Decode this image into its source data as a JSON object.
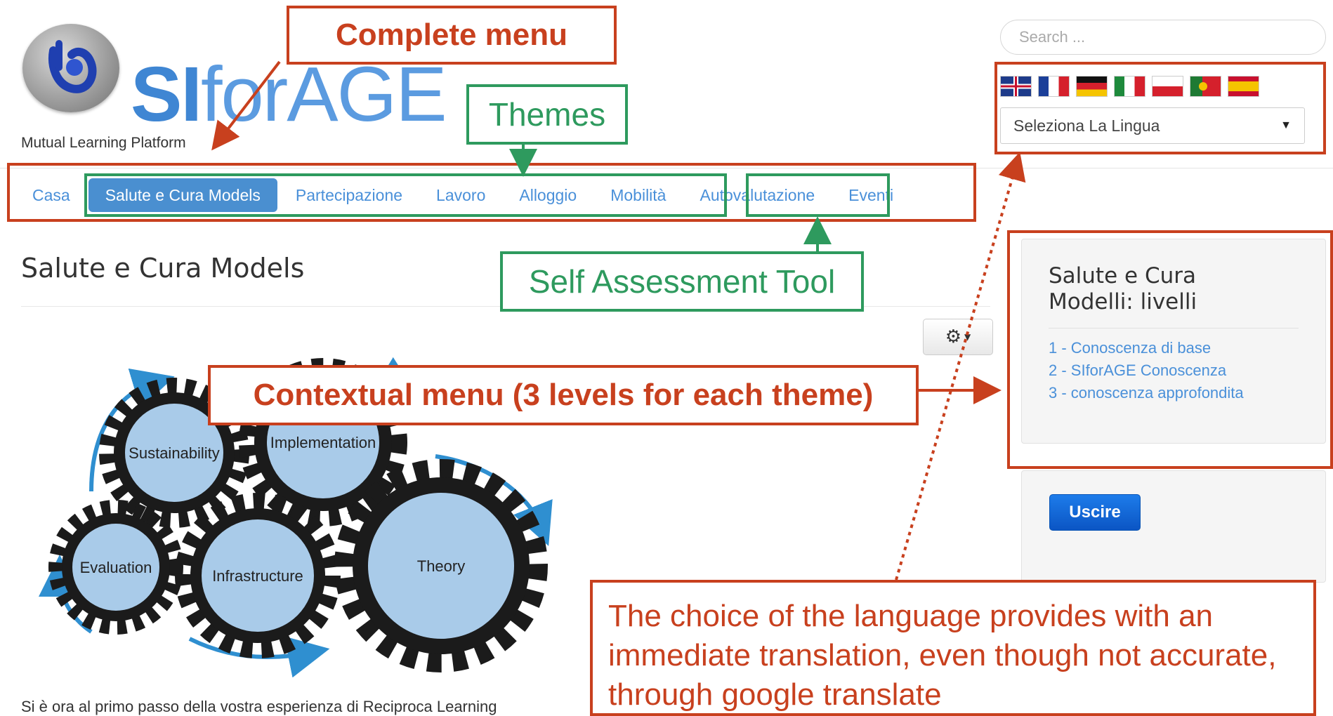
{
  "brand": {
    "logo_text_bold": "SI",
    "logo_text_rest": "forAGE",
    "tagline": "Mutual Learning Platform"
  },
  "search": {
    "placeholder": "Search ..."
  },
  "language": {
    "flags": [
      "uk-flag-icon",
      "france-flag-icon",
      "germany-flag-icon",
      "italy-flag-icon",
      "poland-flag-icon",
      "portugal-flag-icon",
      "spain-flag-icon"
    ],
    "selected": "Seleziona La Lingua"
  },
  "nav": {
    "items": [
      "Casa",
      "Salute e Cura Models",
      "Partecipazione",
      "Lavoro",
      "Alloggio",
      "Mobilità",
      "Autovalutazione",
      "Eventi"
    ],
    "active_index": 1
  },
  "main": {
    "title": "Salute e Cura Models",
    "gear_labels": [
      "Sustainability",
      "Implementation",
      "Evaluation",
      "Infrastructure",
      "Theory"
    ],
    "intro_text": "Si è ora al primo passo della vostra esperienza di Reciproca Learning"
  },
  "sidebar": {
    "panel_title": "Salute e Cura\nModelli: livelli",
    "links": [
      "1 - Conoscenza di base",
      "2 - SIforAGE Conoscenza",
      "3 - conoscenza approfondita"
    ],
    "logout_label": "Uscire"
  },
  "annotations": {
    "complete_menu": "Complete menu",
    "themes": "Themes",
    "self_assessment": "Self Assessment Tool",
    "contextual_menu": "Contextual menu (3 levels for each theme)",
    "language_note": "The choice of the language provides with an immediate translation, even though not accurate, through google translate"
  },
  "colors": {
    "annotation_red": "#c8401e",
    "annotation_green": "#2e9a5e",
    "link_blue": "#4a90d9",
    "active_nav": "#4a8fd0"
  }
}
